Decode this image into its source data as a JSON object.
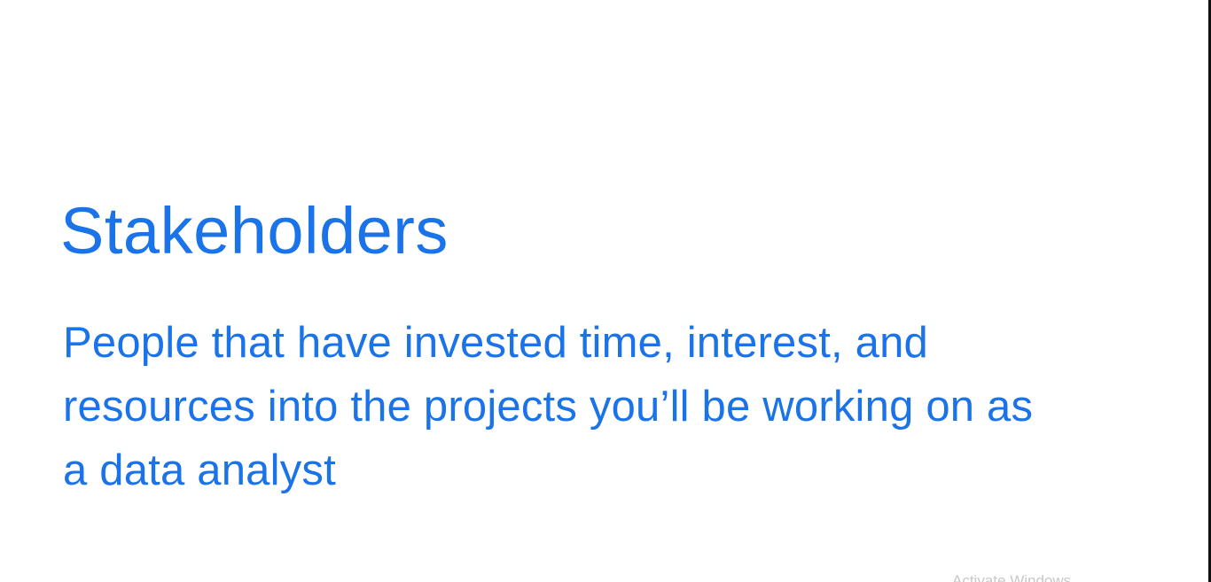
{
  "slide": {
    "title": "Stakeholders",
    "definition": "People that have invested time, interest, and resources into the projects you’ll be working on as a data analyst",
    "accent_color": "#1a73e8"
  },
  "overlay": {
    "watermark": "Activate Windows"
  }
}
